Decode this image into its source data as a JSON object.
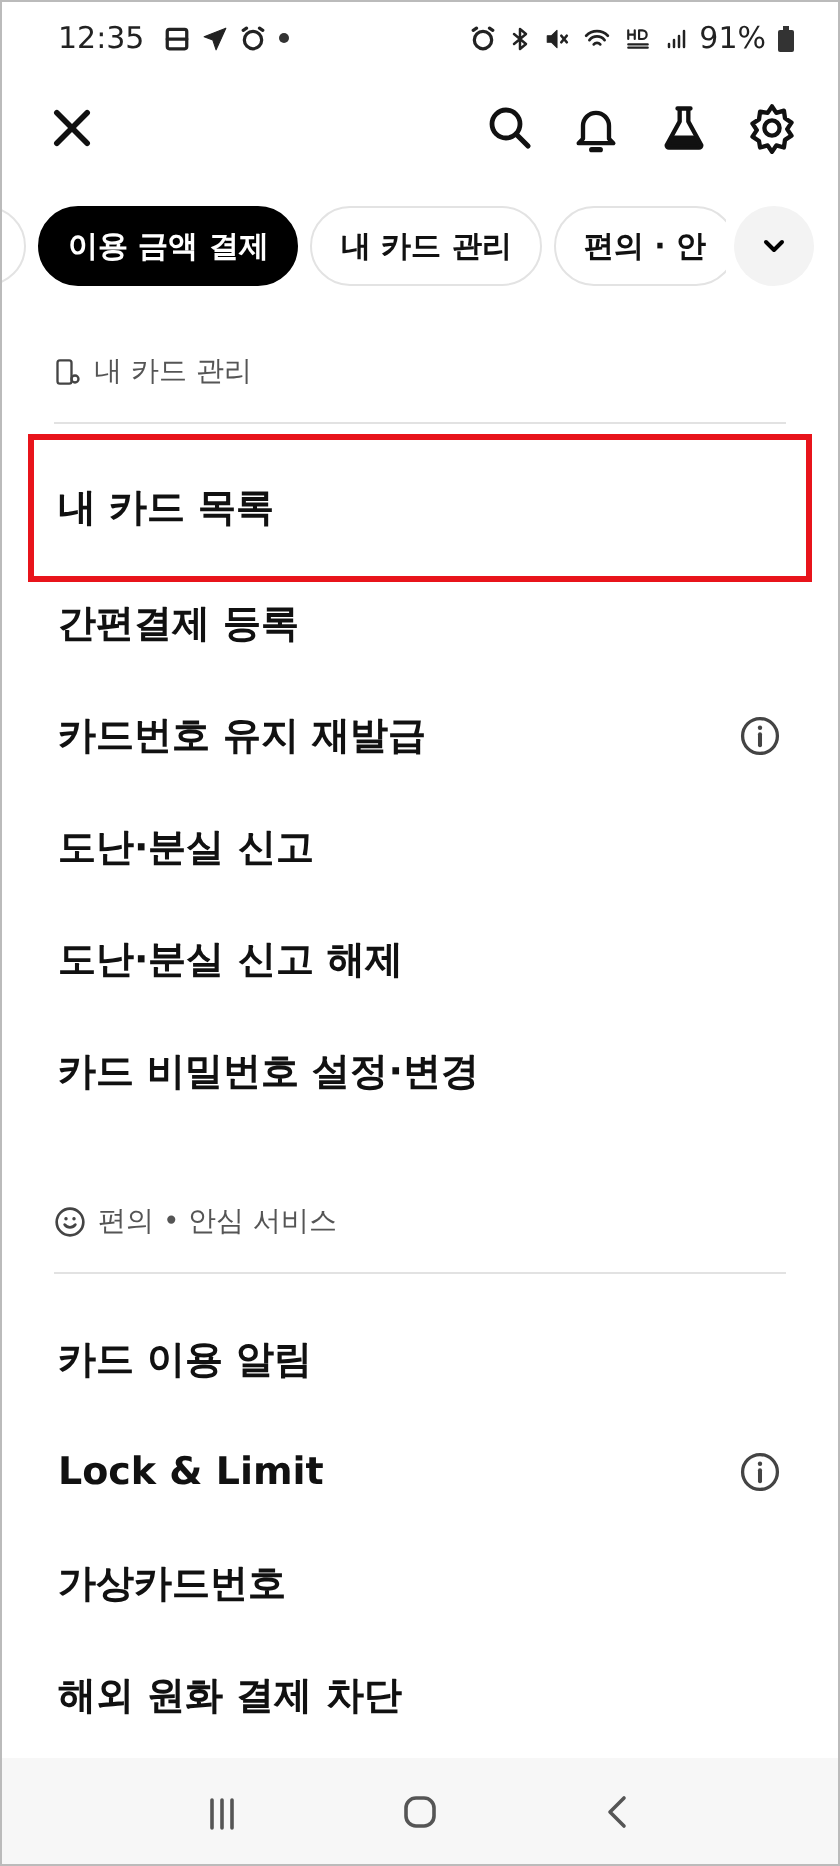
{
  "status_bar": {
    "time": "12:35",
    "battery": "91%"
  },
  "chips": [
    {
      "selected": false
    },
    {
      "label": "이용 금액 결제",
      "selected": true
    },
    {
      "label": "내 카드 관리",
      "selected": false
    },
    {
      "label": "편의 · 안",
      "selected": false
    }
  ],
  "sections": [
    {
      "title": "내 카드 관리",
      "items": [
        {
          "label": "내 카드 목록",
          "info": false,
          "highlighted": true
        },
        {
          "label": "간편결제 등록",
          "info": false,
          "highlighted": false
        },
        {
          "label": "카드번호 유지 재발급",
          "info": true,
          "highlighted": false
        },
        {
          "label": "도난·분실 신고",
          "info": false,
          "highlighted": false
        },
        {
          "label": "도난·분실 신고 해제",
          "info": false,
          "highlighted": false
        },
        {
          "label": "카드 비밀번호 설정·변경",
          "info": false,
          "highlighted": false
        }
      ]
    },
    {
      "title": "편의 • 안심 서비스",
      "items": [
        {
          "label": "카드 이용 알림",
          "info": false,
          "highlighted": false
        },
        {
          "label": "Lock & Limit",
          "info": true,
          "highlighted": false
        },
        {
          "label": "가상카드번호",
          "info": false,
          "highlighted": false
        },
        {
          "label": "해외 원화 결제 차단",
          "info": false,
          "highlighted": false
        }
      ]
    }
  ]
}
